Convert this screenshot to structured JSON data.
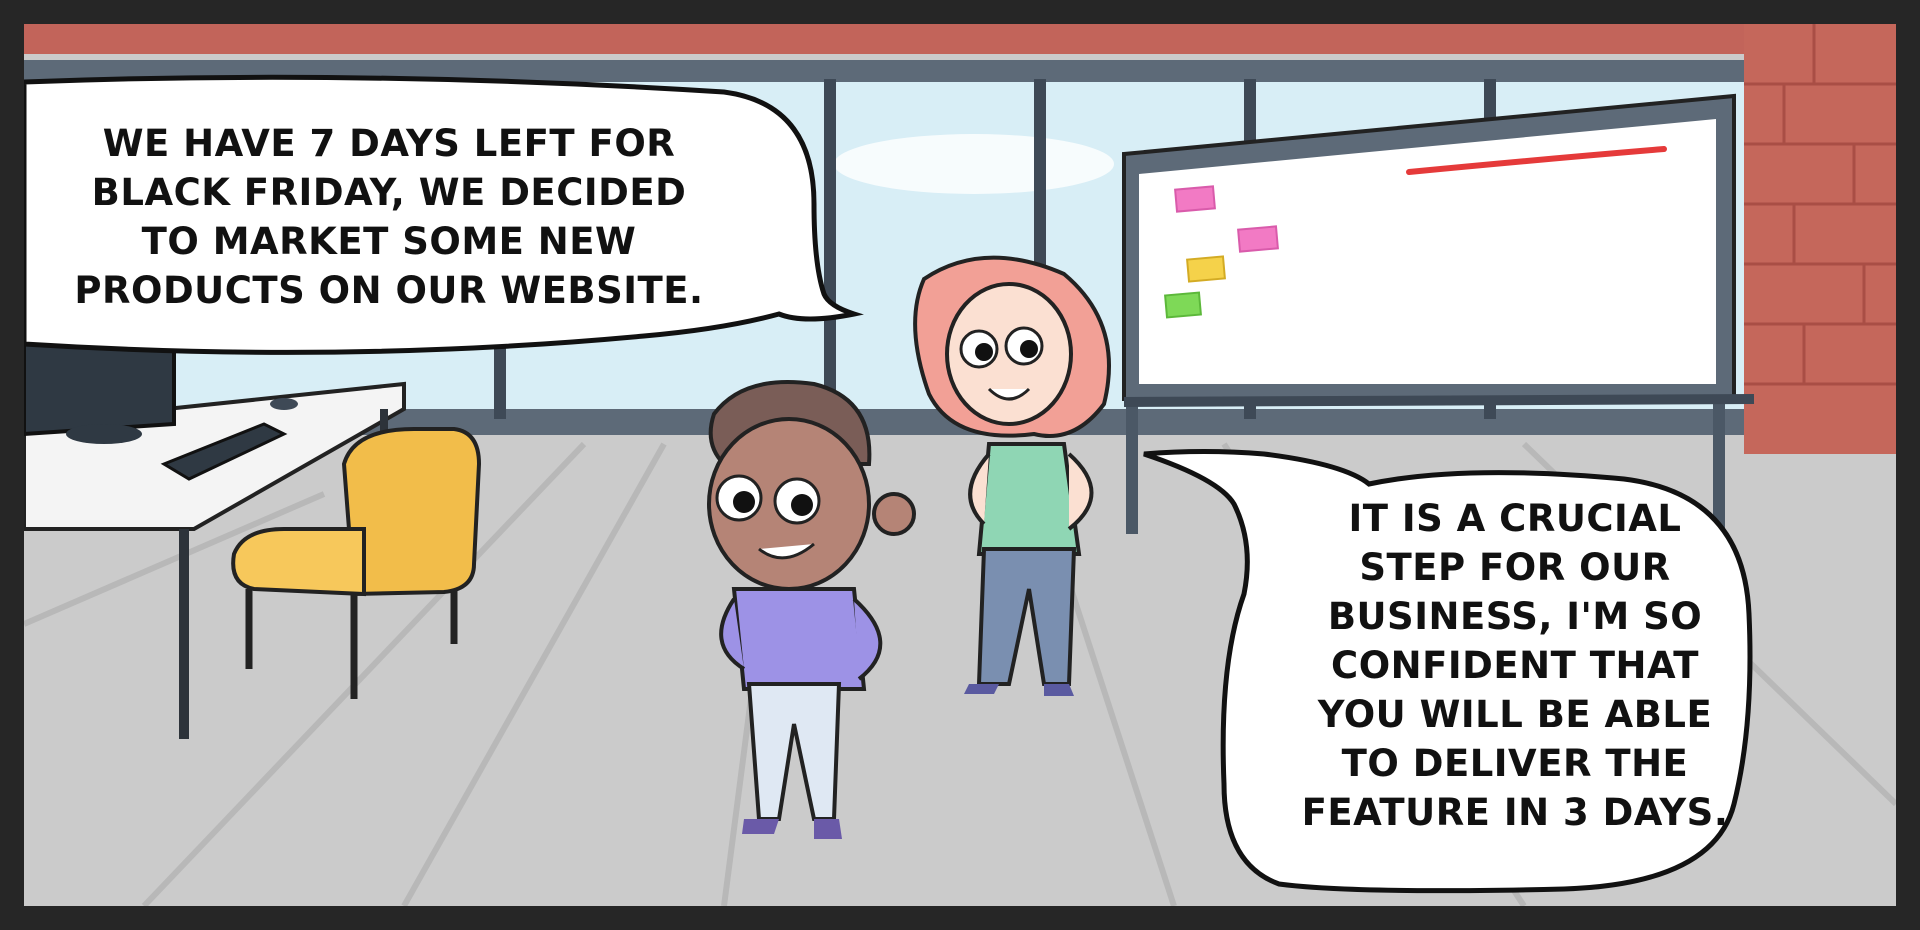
{
  "comic": {
    "bubble_left": {
      "lines": [
        "WE HAVE 7 DAYS LEFT FOR",
        "BLACK FRIDAY, WE DECIDED",
        "TO MARKET SOME NEW",
        "PRODUCTS ON OUR WEBSITE."
      ]
    },
    "bubble_right": {
      "lines": [
        "IT IS A CRUCIAL",
        "STEP FOR OUR",
        "BUSINESS, I'M SO",
        "CONFIDENT THAT",
        "YOU WILL BE ABLE",
        "TO  DELIVER THE",
        "FEATURE IN 3 DAYS."
      ]
    }
  },
  "colors": {
    "frame": "#262626",
    "brick": "#c2645a",
    "floor": "#c9c9c9",
    "sky": "#d8eef6",
    "window_frame": "#5d6a78",
    "chair": "#f2bd4a",
    "boy_shirt": "#9d92e6",
    "girl_shirt": "#8fd6b4",
    "girl_hair": "#f2a096",
    "accent_red": "#e53a3a"
  },
  "icons": [
    "desk-icon",
    "monitor-icon",
    "keyboard-icon",
    "chair-icon",
    "whiteboard-icon",
    "sticky-note-icon"
  ]
}
